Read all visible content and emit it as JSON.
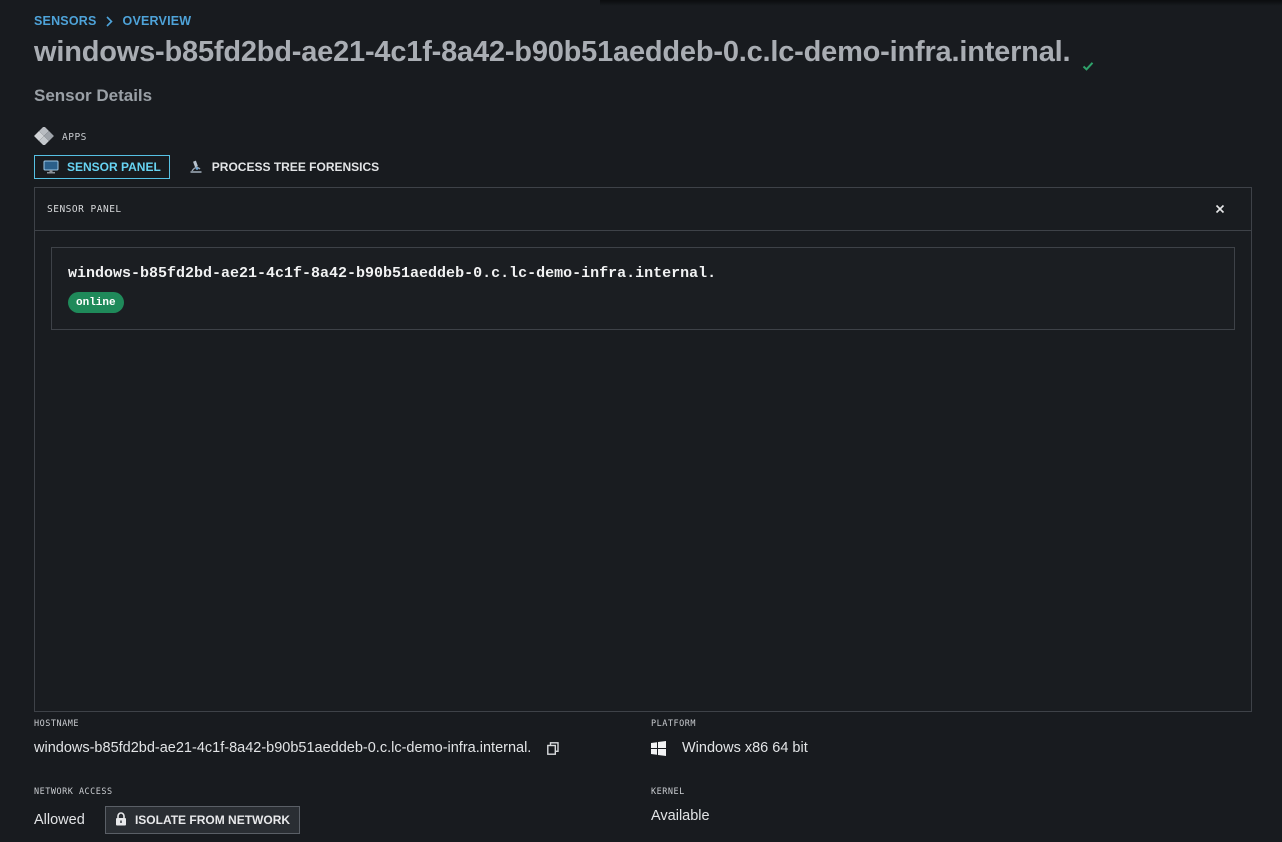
{
  "breadcrumb": {
    "items": [
      "SENSORS",
      "OVERVIEW"
    ]
  },
  "page": {
    "title": "windows-b85fd2bd-ae21-4c1f-8a42-b90b51aeddeb-0.c.lc-demo-infra.internal.",
    "subtitle": "Sensor Details",
    "status_icon": "check-icon"
  },
  "apps": {
    "label": "APPS",
    "icon": "apps-diamond-icon"
  },
  "tabs": [
    {
      "label": "SENSOR PANEL",
      "icon": "monitor-icon",
      "active": true
    },
    {
      "label": "PROCESS TREE FORENSICS",
      "icon": "microscope-icon",
      "active": false
    }
  ],
  "panel": {
    "title": "SENSOR PANEL",
    "close_icon": "close-icon",
    "card": {
      "hostname": "windows-b85fd2bd-ae21-4c1f-8a42-b90b51aeddeb-0.c.lc-demo-infra.internal.",
      "status": "online"
    }
  },
  "details": {
    "hostname_label": "HOSTNAME",
    "hostname_value": "windows-b85fd2bd-ae21-4c1f-8a42-b90b51aeddeb-0.c.lc-demo-infra.internal.",
    "platform_label": "PLATFORM",
    "platform_value": "Windows x86 64 bit",
    "network_label": "NETWORK ACCESS",
    "network_value": "Allowed",
    "isolate_label": "ISOLATE FROM NETWORK",
    "kernel_label": "KERNEL",
    "kernel_value": "Available"
  },
  "colors": {
    "background": "#181b1f",
    "accent": "#4ea3d9",
    "tab_active": "#56c1e4",
    "online": "#1f8a5a",
    "check": "#2fa36b"
  }
}
